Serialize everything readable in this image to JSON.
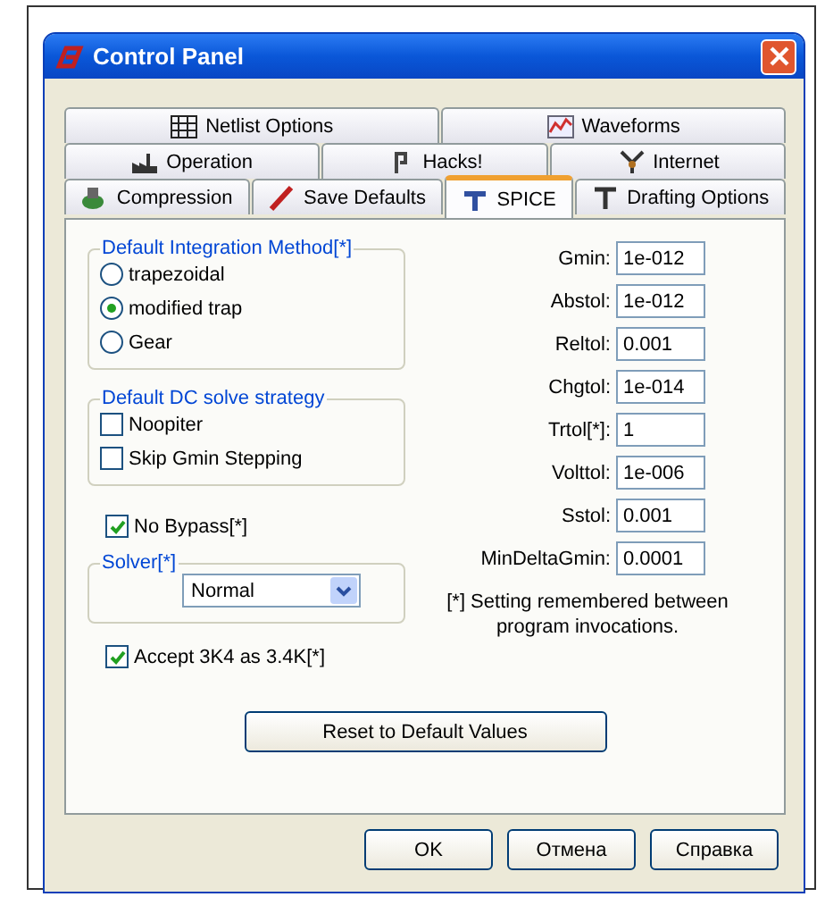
{
  "window": {
    "title": "Control Panel"
  },
  "tab_rows": [
    [
      {
        "label": "Netlist Options",
        "selected": false
      },
      {
        "label": "Waveforms",
        "selected": false
      }
    ],
    [
      {
        "label": "Operation",
        "selected": false
      },
      {
        "label": "Hacks!",
        "selected": false
      },
      {
        "label": "Internet",
        "selected": false
      }
    ],
    [
      {
        "label": "Compression",
        "selected": false
      },
      {
        "label": "Save Defaults",
        "selected": false
      },
      {
        "label": "SPICE",
        "selected": true
      },
      {
        "label": "Drafting Options",
        "selected": false
      }
    ]
  ],
  "integration_group": {
    "title": "Default Integration Method[*]",
    "options": [
      {
        "label": "trapezoidal",
        "selected": false
      },
      {
        "label": "modified trap",
        "selected": true
      },
      {
        "label": "Gear",
        "selected": false
      }
    ]
  },
  "dc_group": {
    "title": "Default DC solve strategy",
    "options": [
      {
        "label": "Noopiter",
        "checked": false
      },
      {
        "label": "Skip Gmin Stepping",
        "checked": false
      }
    ]
  },
  "no_bypass": {
    "label": "No Bypass[*]",
    "checked": true
  },
  "solver_group": {
    "title": "Solver[*]",
    "value": "Normal"
  },
  "accept_3k4": {
    "label": "Accept 3K4 as 3.4K[*]",
    "checked": true
  },
  "parameters": [
    {
      "label": "Gmin:",
      "value": "1e-012"
    },
    {
      "label": "Abstol:",
      "value": "1e-012"
    },
    {
      "label": "Reltol:",
      "value": "0.001"
    },
    {
      "label": "Chgtol:",
      "value": "1e-014"
    },
    {
      "label": "Trtol[*]:",
      "value": "1"
    },
    {
      "label": "Volttol:",
      "value": "1e-006"
    },
    {
      "label": "Sstol:",
      "value": "0.001"
    },
    {
      "label": "MinDeltaGmin:",
      "value": "0.0001"
    }
  ],
  "note": "[*] Setting remembered between program invocations.",
  "reset_button": "Reset to Default Values",
  "buttons": [
    "OK",
    "Отмена",
    "Справка"
  ]
}
